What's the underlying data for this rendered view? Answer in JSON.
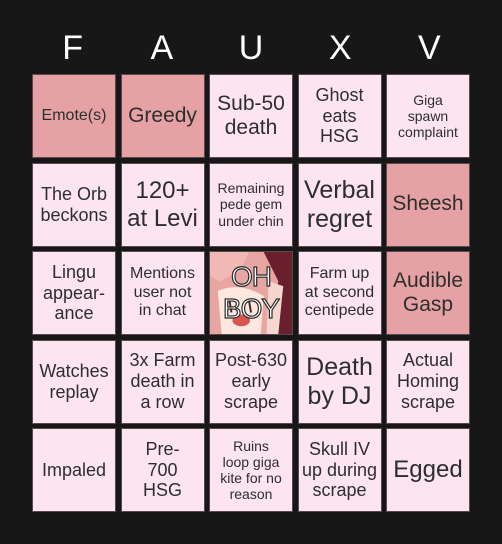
{
  "header": {
    "letters": [
      "F",
      "A",
      "U",
      "X",
      "V"
    ]
  },
  "colors": {
    "background": "#171717",
    "cell_default": "#fce4f0",
    "cell_marked": "#e5a1a3",
    "text": "#2e2e2e",
    "header_text": "#ffffff"
  },
  "board": {
    "cells": [
      {
        "text": "Emote(s)",
        "marked": true
      },
      {
        "text": "Greedy",
        "marked": true
      },
      {
        "text": "Sub-50\ndeath",
        "marked": false
      },
      {
        "text": "Ghost\neats\nHSG",
        "marked": false
      },
      {
        "text": "Giga\nspawn\ncomplaint",
        "marked": false
      },
      {
        "text": "The Orb\nbeckons",
        "marked": false
      },
      {
        "text": "120+\nat Levi",
        "marked": false
      },
      {
        "text": "Remaining\npede gem\nunder chin",
        "marked": false
      },
      {
        "text": "Verbal\nregret",
        "marked": false
      },
      {
        "text": "Sheesh",
        "marked": true
      },
      {
        "text": "Lingu\nappear-\nance",
        "marked": false
      },
      {
        "text": "Mentions\nuser not\nin chat",
        "marked": false
      },
      {
        "text": "OH\nBOY",
        "marked": false,
        "free": true,
        "image": "anime-character-face"
      },
      {
        "text": "Farm up\nat second\ncentipede",
        "marked": false
      },
      {
        "text": "Audible\nGasp",
        "marked": true
      },
      {
        "text": "Watches\nreplay",
        "marked": false
      },
      {
        "text": "3x Farm\ndeath in\na row",
        "marked": false
      },
      {
        "text": "Post-630\nearly\nscrape",
        "marked": false
      },
      {
        "text": "Death\nby DJ",
        "marked": false
      },
      {
        "text": "Actual\nHoming\nscrape",
        "marked": false
      },
      {
        "text": "Impaled",
        "marked": false
      },
      {
        "text": "Pre-\n700\nHSG",
        "marked": false
      },
      {
        "text": "Ruins\nloop giga\nkite for no\nreason",
        "marked": false
      },
      {
        "text": "Skull IV\nup during\nscrape",
        "marked": false
      },
      {
        "text": "Egged",
        "marked": false
      }
    ]
  }
}
